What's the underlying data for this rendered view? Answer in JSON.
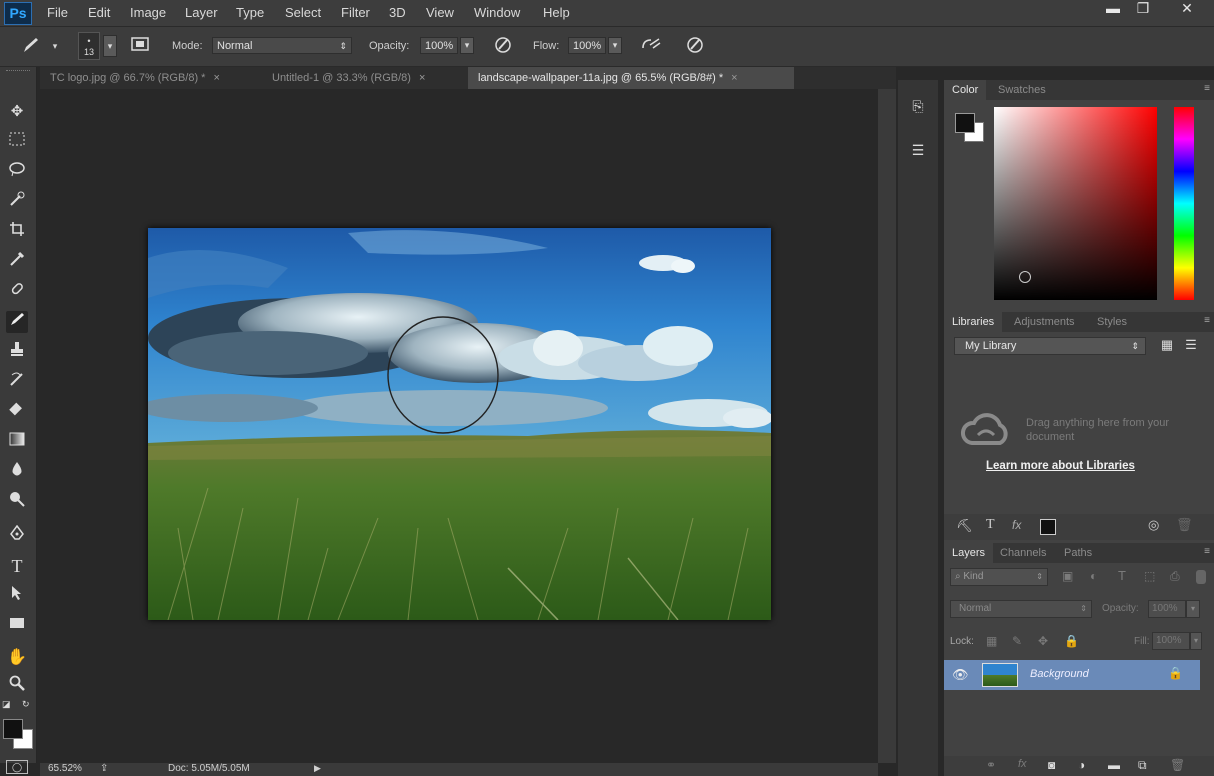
{
  "app": {
    "logo": "Ps",
    "menu": [
      "File",
      "Edit",
      "Image",
      "Layer",
      "Type",
      "Select",
      "Filter",
      "3D",
      "View",
      "Window",
      "Help"
    ],
    "window_controls": {
      "minimize": "minimize-icon",
      "restore": "restore-icon",
      "close": "close-icon"
    }
  },
  "options": {
    "brush_size": "13",
    "mode_label": "Mode:",
    "mode_value": "Normal",
    "opacity_label": "Opacity:",
    "opacity_value": "100%",
    "flow_label": "Flow:",
    "flow_value": "100%"
  },
  "tabs": [
    {
      "label": "TC logo.jpg @ 66.7% (RGB/8) *",
      "close": "×"
    },
    {
      "label": "Untitled-1 @ 33.3% (RGB/8)",
      "close": "×"
    },
    {
      "label": "landscape-wallpaper-11a.jpg @ 65.5% (RGB/8#) *",
      "close": "×",
      "active": true
    }
  ],
  "status": {
    "zoom": "65.52%",
    "doc": "Doc: 5.05M/5.05M"
  },
  "color_panel": {
    "tabs": [
      "Color",
      "Swatches"
    ],
    "active_hue": "#ff0000"
  },
  "libraries_panel": {
    "tabs": [
      "Libraries",
      "Adjustments",
      "Styles"
    ],
    "library": "My Library",
    "drag_text": "Drag anything here from your document",
    "learn_more": "Learn more about Libraries"
  },
  "layers_panel": {
    "tabs": [
      "Layers",
      "Channels",
      "Paths"
    ],
    "filter": "Kind",
    "blend": "Normal",
    "opacity_label": "Opacity:",
    "opacity_value": "100%",
    "lock_label": "Lock:",
    "fill_label": "Fill:",
    "fill_value": "100%",
    "layers": [
      {
        "name": "Background",
        "visible": true,
        "locked": true
      }
    ]
  }
}
